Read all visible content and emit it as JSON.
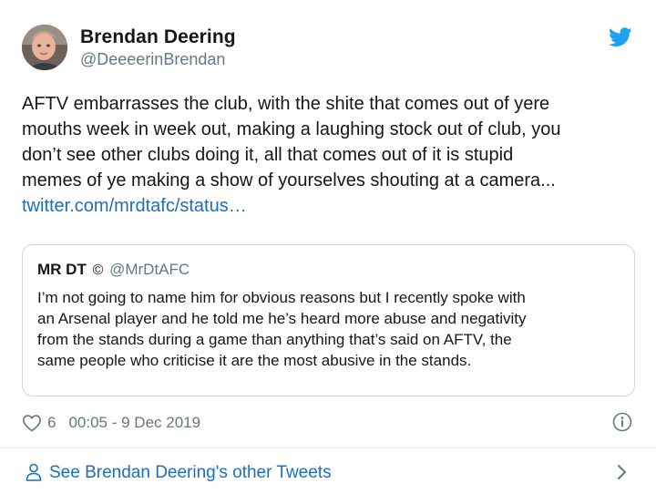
{
  "author": {
    "name": "Brendan Deering",
    "handle": "@DeeeerinBrendan"
  },
  "tweet": {
    "lines": [
      "AFTV embarrasses the club, with the shite that comes out of yere",
      "mouths week in week out, making a laughing stock out of club, you",
      "don’t see other clubs doing it, all that comes out of it is stupid",
      "memes of ye making a show of yourselves shouting at a camera..."
    ],
    "link": "twitter.com/mrdtafc/status…"
  },
  "quote": {
    "name": "MR DT",
    "copyright": "©",
    "handle": "@MrDtAFC",
    "lines": [
      "I’m not going to name him for obvious reasons but I recently spoke with",
      "an Arsenal player and he told me he’s heard more abuse and negativity",
      "from the stands during a game than anything that’s said on AFTV, the",
      "same people who criticise it are the most abusive in the stands."
    ]
  },
  "meta": {
    "likes": "6",
    "timestamp": "00:05 - 9 Dec 2019"
  },
  "footer": {
    "see_more": "See Brendan Deering's other Tweets"
  },
  "icons": {
    "brand": "twitter-bird-icon",
    "like": "heart-icon",
    "info": "info-icon",
    "profile": "person-icon",
    "next": "chevron-right-icon"
  },
  "colors": {
    "twitter_blue": "#1da1f2",
    "link": "#1b6fbf",
    "secondary_text": "#657786",
    "border": "#ccd6dd"
  }
}
